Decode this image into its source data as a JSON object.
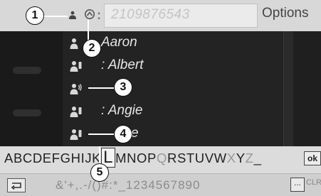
{
  "header": {
    "phone_number": "2109876543",
    "colon": ":",
    "options_label": "Options"
  },
  "contacts": [
    {
      "name": "Aaron"
    },
    {
      "name": ": Albert"
    },
    {
      "name": ""
    },
    {
      "name": ": Angie"
    },
    {
      "name": "e"
    }
  ],
  "keyboard": {
    "letters_a": "ABCDEFGH",
    "letters_b": "IJK",
    "selected_letter": "L",
    "letters_c": "MNOP",
    "letters_q": "Q",
    "letters_d": "RSTUVW",
    "letters_x": "X",
    "letters_y": "Y",
    "letters_z": "Z",
    "letters_dash": "_",
    "ok_label": "ok",
    "symbols": "&'+,.-/()#:*_1234567890",
    "dots_label": "...",
    "clr_label": "CLR"
  },
  "callouts": [
    "1",
    "2",
    "3",
    "4",
    "5"
  ],
  "colors": {
    "screen_bg": "#1c1c1c",
    "header_bg": "#d8d8d8",
    "keyboard_bg": "#dcdcdc",
    "contact_text": "#e6e6e6"
  }
}
